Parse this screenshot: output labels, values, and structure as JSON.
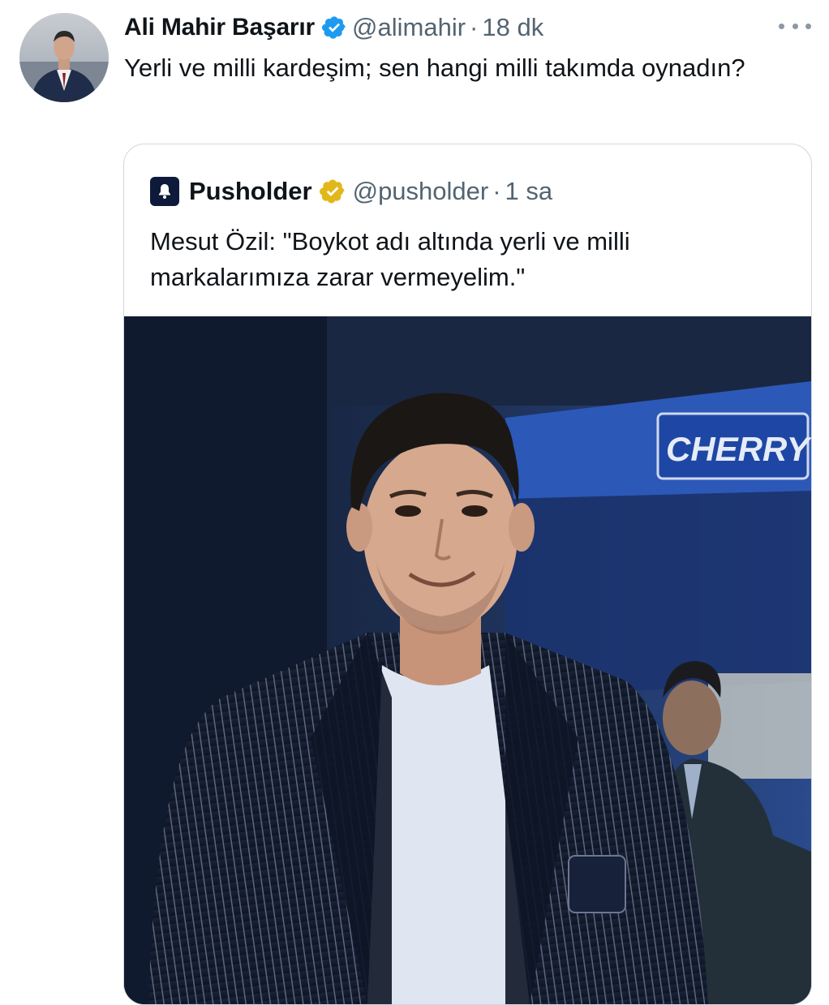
{
  "tweet": {
    "author_name": "Ali Mahir Başarır",
    "handle": "@alimahir",
    "separator": "·",
    "time": "18 dk",
    "text": "Yerli ve milli kardeşim; sen hangi milli takımda oynadın?",
    "avatar_icon": "profile-photo",
    "verified_icon": "blue-verified-badge",
    "more_icon": "more-options-icon"
  },
  "quote": {
    "author_name": "Pusholder",
    "handle": "@pusholder",
    "separator": "·",
    "time": "1 sa",
    "text": "Mesut Özil: \"Boykot adı altında yerli ve milli markalarımıza zarar vermeyelim.\"",
    "logo_icon": "bell-icon",
    "verified_icon": "gold-verified-badge",
    "photo": {
      "description_icon": "news-photo",
      "sign_text": "CHERRY"
    }
  },
  "colors": {
    "blue_badge": "#1d9bf0",
    "gold_badge": "#e2b719",
    "secondary_text": "#536471",
    "border": "#cfd9de"
  }
}
